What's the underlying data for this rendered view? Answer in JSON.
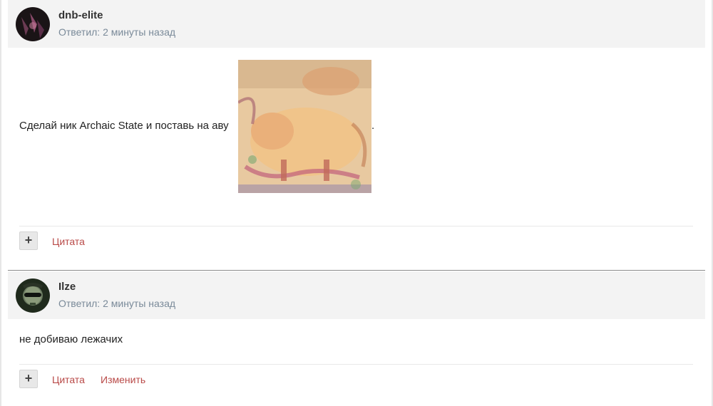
{
  "posts": [
    {
      "author": "dnb-elite",
      "meta": "Ответил: 2 минуты назад",
      "text": "Сделай ник Archaic State и поставь на аву",
      "text_suffix": ".",
      "image_icon": "pig-painting-image",
      "plus_label": "+",
      "quote_label": "Цитата"
    },
    {
      "author": "Ilze",
      "meta": "Ответил: 2 минуты назад",
      "text": "не добиваю лежачих",
      "plus_label": "+",
      "quote_label": "Цитата",
      "edit_label": "Изменить"
    }
  ],
  "colors": {
    "header_bg": "#f3f3f3",
    "meta_text": "#7a8a99",
    "action_link": "#b94a48"
  }
}
